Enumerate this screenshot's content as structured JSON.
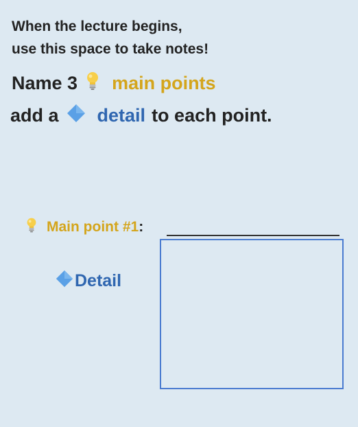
{
  "intro": {
    "line1": "When the lecture begins,",
    "line2": "use this space to take notes!"
  },
  "instruction": {
    "name_prefix": "Name 3",
    "main_points": "main points",
    "add_prefix": "add a",
    "detail_word": "detail",
    "add_suffix": "to each point."
  },
  "main_point": {
    "label": "Main point #1",
    "colon": ":"
  },
  "detail": {
    "label": "Detail"
  },
  "colors": {
    "background": "#dde9f2",
    "gold": "#d4a51c",
    "blue": "#2f66b0",
    "diamond": "#5aa0e6",
    "box_border": "#4a7bd0"
  },
  "icons": {
    "bulb": "lightbulb-icon",
    "diamond": "blue-diamond-icon"
  }
}
